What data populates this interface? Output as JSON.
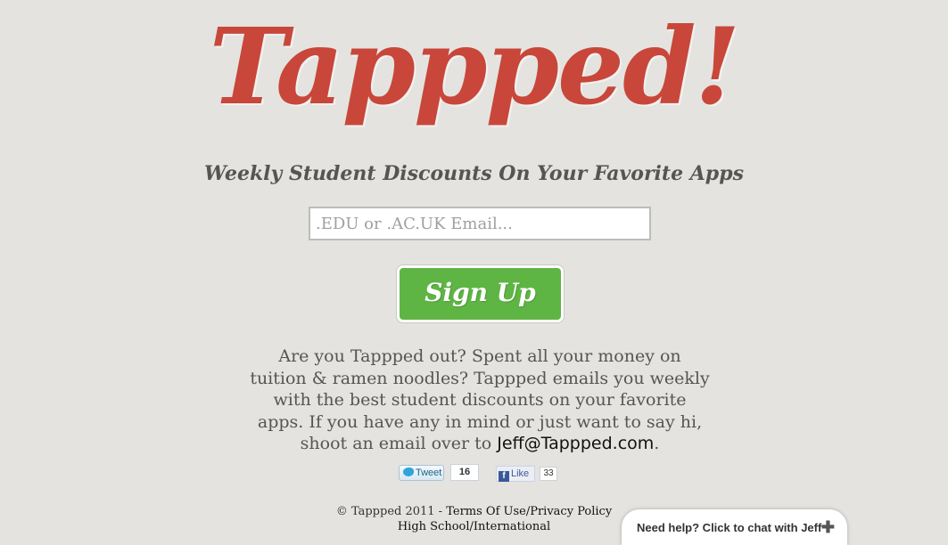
{
  "logo": {
    "text": "Tappped!",
    "color": "#c8473a"
  },
  "tagline": "Weekly Student Discounts On Your Favorite Apps",
  "signup_form": {
    "email_placeholder": ".EDU or .AC.UK Email...",
    "email_value": "",
    "button_label": "Sign Up",
    "button_color": "#5fb544"
  },
  "description": {
    "text": "Are you Tappped out? Spent all your money on tuition & ramen noodles? Tappped emails you weekly with the best student discounts on your favorite apps. If you have any in mind or just want to say hi, shoot an email over to ",
    "email_link": "Jeff@Tappped.com",
    "trailing": "."
  },
  "social": {
    "tweet_label": "Tweet",
    "tweet_count": "16",
    "tweet_icon": "twitter-bird-icon",
    "like_label": "Like",
    "like_count": "33",
    "like_icon": "facebook-icon"
  },
  "footer": {
    "copyright": "© Tappped 2011 - ",
    "terms_link": "Terms Of Use/Privacy Policy",
    "second_link": "High School/International"
  },
  "chat_widget": {
    "label": "Need help? Click to chat with Jeff",
    "icon": "plus-icon"
  }
}
